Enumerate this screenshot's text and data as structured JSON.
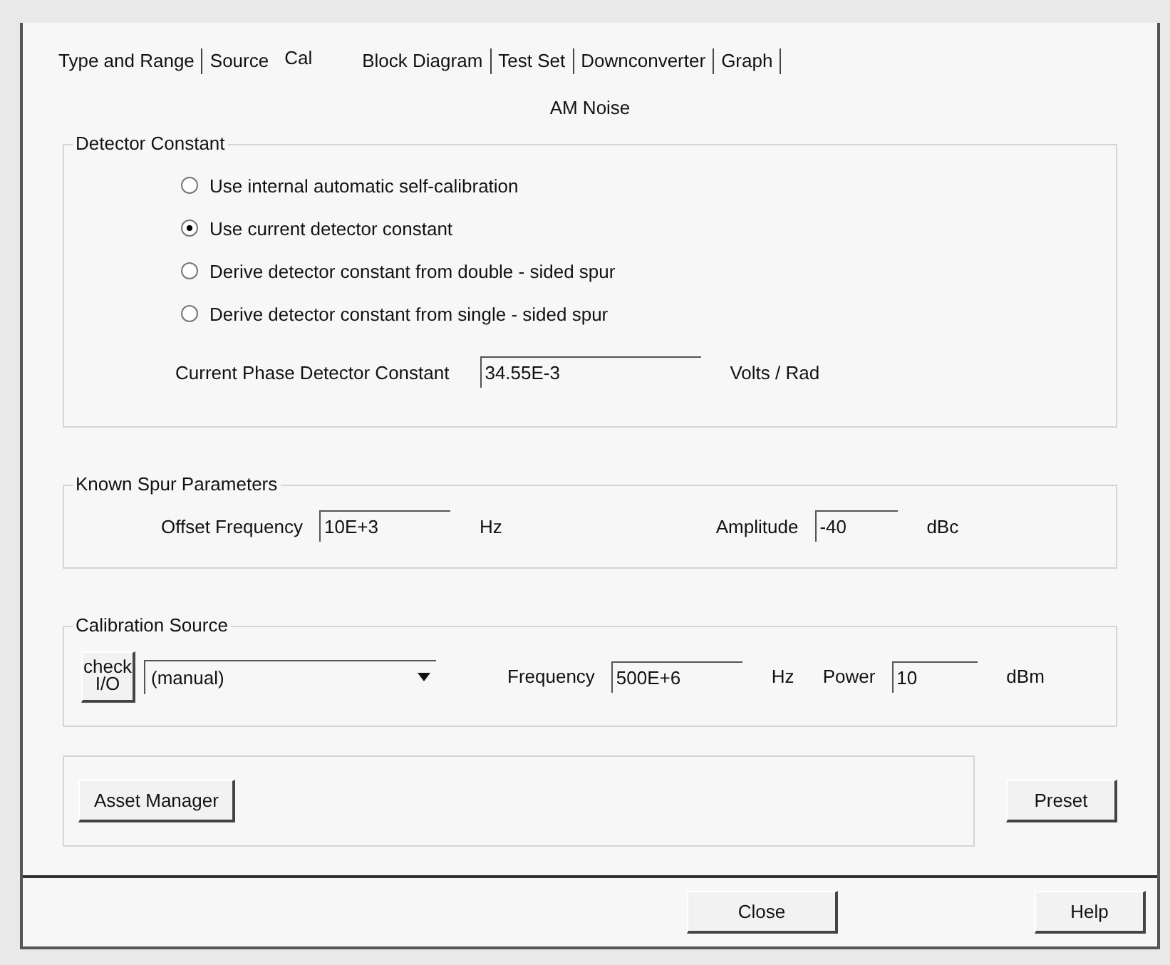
{
  "tabs": [
    {
      "label": "Type and Range",
      "selected": false
    },
    {
      "label": "Source",
      "selected": false
    },
    {
      "label": "Cal",
      "selected": true
    },
    {
      "label": "Block Diagram",
      "selected": false
    },
    {
      "label": "Test Set",
      "selected": false
    },
    {
      "label": "Downconverter",
      "selected": false
    },
    {
      "label": "Graph",
      "selected": false
    }
  ],
  "mode_title": "AM Noise",
  "detector_constant": {
    "title": "Detector Constant",
    "options": [
      {
        "label": "Use internal automatic self-calibration",
        "selected": false
      },
      {
        "label": "Use current detector constant",
        "selected": true
      },
      {
        "label": "Derive detector constant from double - sided spur",
        "selected": false
      },
      {
        "label": "Derive detector constant from single - sided spur",
        "selected": false
      }
    ],
    "constant_field": {
      "label": "Current Phase Detector Constant",
      "value": "34.55E-3",
      "unit": "Volts / Rad"
    }
  },
  "known_spur": {
    "title": "Known Spur Parameters",
    "offset_frequency": {
      "label": "Offset Frequency",
      "value": "10E+3",
      "unit": "Hz"
    },
    "amplitude": {
      "label": "Amplitude",
      "value": "-40",
      "unit": "dBc"
    }
  },
  "calibration_source": {
    "title": "Calibration Source",
    "check_button": [
      "check",
      "I/O"
    ],
    "source": "(manual)",
    "frequency": {
      "label": "Frequency",
      "value": "500E+6",
      "unit": "Hz"
    },
    "power": {
      "label": "Power",
      "value": "10",
      "unit": "dBm"
    }
  },
  "asset_manager_button": "Asset Manager",
  "preset_button": "Preset",
  "close_button": "Close",
  "help_button": "Help"
}
